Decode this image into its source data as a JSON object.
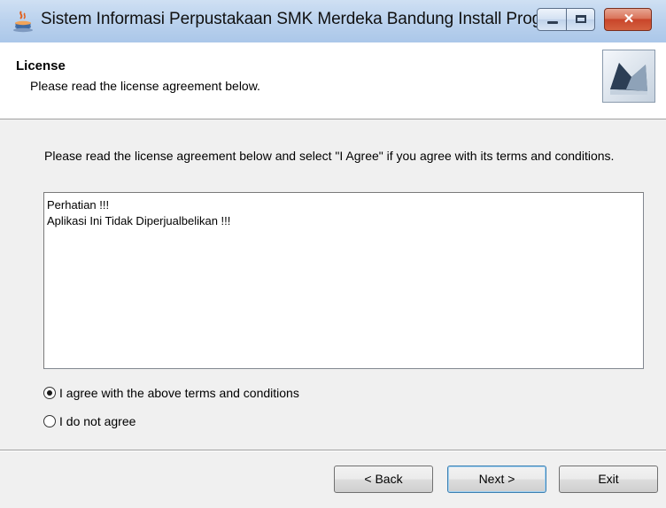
{
  "window": {
    "title": "Sistem Informasi Perpustakaan SMK Merdeka Bandung Install Prog",
    "controls": {
      "minimize": "minimize",
      "maximize": "maximize",
      "close": "✕"
    }
  },
  "header": {
    "title": "License",
    "subtitle": "Please read the license agreement below."
  },
  "body": {
    "intro": "Please read the license agreement below and select \"I Agree\" if you agree with its terms and conditions.",
    "license_lines": [
      "Perhatian !!!",
      "Aplikasi Ini Tidak Diperjualbelikan !!!"
    ],
    "options": [
      {
        "label": "I agree with the above terms and conditions",
        "selected": true
      },
      {
        "label": "I do not agree",
        "selected": false
      }
    ]
  },
  "buttons": {
    "back": "< Back",
    "next": "Next >",
    "exit": "Exit"
  },
  "colors": {
    "titlebar": "#bcd3ee",
    "close_button": "#c9452a",
    "default_button_border": "#3c7fb1"
  }
}
